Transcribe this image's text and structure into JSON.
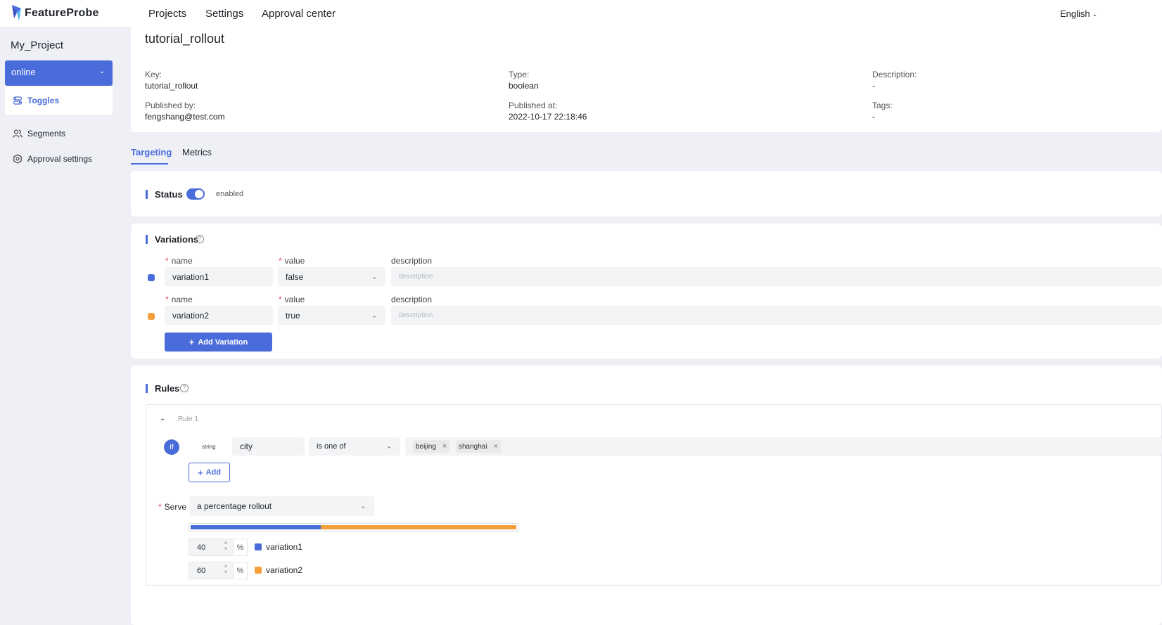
{
  "brand": {
    "name": "FeatureProbe"
  },
  "topnav": {
    "items": [
      "Projects",
      "Settings",
      "Approval center"
    ],
    "language": "English"
  },
  "sidebar": {
    "project_name": "My_Project",
    "environment": "online",
    "items": [
      {
        "label": "Toggles",
        "icon": "toggle-icon",
        "active": true
      },
      {
        "label": "Segments",
        "icon": "users-icon",
        "active": false
      },
      {
        "label": "Approval settings",
        "icon": "gear-icon",
        "active": false
      }
    ]
  },
  "toggle": {
    "title": "tutorial_rollout",
    "key_label": "Key:",
    "key": "tutorial_rollout",
    "type_label": "Type:",
    "type": "boolean",
    "description_label": "Description:",
    "description": "-",
    "published_by_label": "Published by:",
    "published_by": "fengshang@test.com",
    "published_at_label": "Published at:",
    "published_at": "2022-10-17 22:18:46",
    "tags_label": "Tags:",
    "tags": "-"
  },
  "tabs": [
    "Targeting",
    "Metrics"
  ],
  "status": {
    "title": "Status",
    "enabled": true,
    "text": "enabled"
  },
  "variations": {
    "title": "Variations",
    "name_label": "name",
    "value_label": "value",
    "description_label": "description",
    "description_placeholder": "description",
    "items": [
      {
        "name": "variation1",
        "value": "false",
        "color": "#4a6cdb"
      },
      {
        "name": "variation2",
        "value": "true",
        "color": "#f5a03a"
      }
    ],
    "add_button": "Add Variation"
  },
  "rules": {
    "title": "Rules",
    "rule": {
      "name": "Rule 1",
      "if_label": "If",
      "type": "string",
      "attribute": "city",
      "operator": "is one of",
      "values": [
        "beijing",
        "shanghai"
      ]
    },
    "add_button": "Add",
    "serve_label": "Serve",
    "serve_value": "a percentage rollout",
    "rollout": [
      {
        "percent": "40",
        "variation": "variation1",
        "color": "#4a6cdb"
      },
      {
        "percent": "60",
        "variation": "variation2",
        "color": "#f5a03a"
      }
    ],
    "percent_sign": "%"
  }
}
